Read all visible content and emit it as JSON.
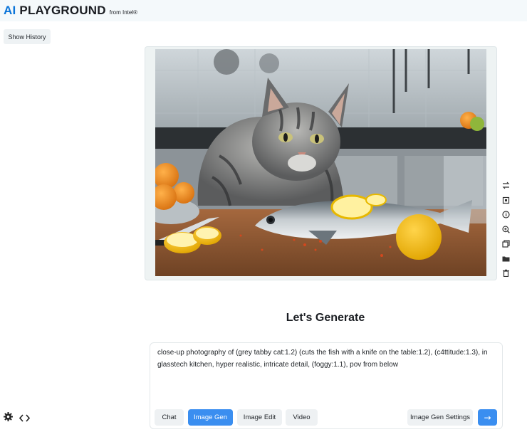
{
  "header": {
    "brand_ai": "AI",
    "brand_playground": "PLAYGROUND",
    "brand_from": "from Intel®"
  },
  "history": {
    "show_label": "Show History"
  },
  "image_actions": [
    {
      "icon": "swap-icon"
    },
    {
      "icon": "crop-icon"
    },
    {
      "icon": "info-icon"
    },
    {
      "icon": "zoom-in-icon"
    },
    {
      "icon": "copy-icon"
    },
    {
      "icon": "folder-icon"
    },
    {
      "icon": "trash-icon"
    }
  ],
  "main": {
    "heading": "Let's Generate",
    "prompt": "close-up photography of (grey tabby cat:1.2) (cuts the fish with a knife on the table:1.2), (c4ttitude:1.3), in glasstech kitchen, hyper realistic, intricate detail, (foggy:1.1), pov from below"
  },
  "modes": {
    "chat": "Chat",
    "image_gen": "Image Gen",
    "image_edit": "Image Edit",
    "video": "Video",
    "active": "Image Gen"
  },
  "toolbar": {
    "settings_label": "Image Gen Settings",
    "send_label": "→"
  },
  "colors": {
    "accent": "#3a8ef0",
    "brand_blue": "#0a74d9",
    "header_bg": "#f4f9fb"
  }
}
